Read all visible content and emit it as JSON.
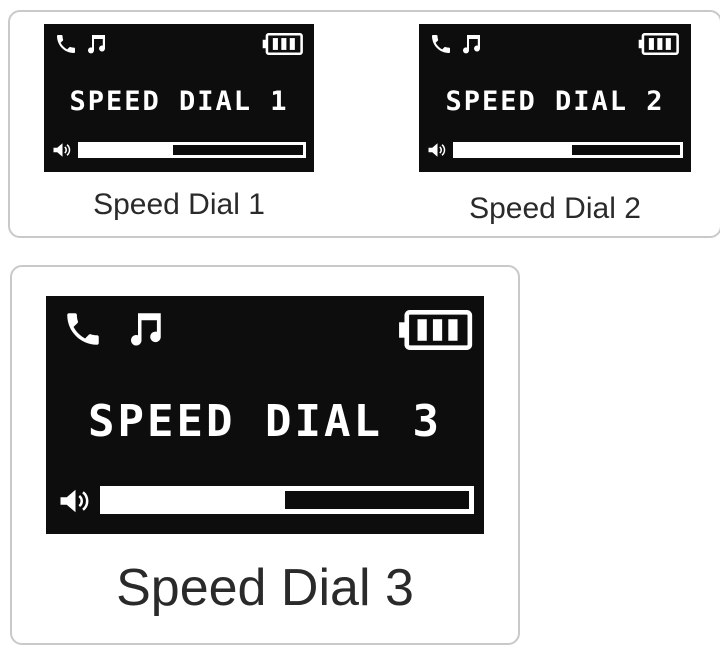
{
  "devices": [
    {
      "screen_text": "SPEED DIAL 1",
      "caption": "Speed Dial 1",
      "volume_fraction": 0.42,
      "status_icons": [
        "phone-icon",
        "music-note-icon"
      ],
      "battery_icon": "battery-full-icon",
      "volume_icon": "speaker-icon"
    },
    {
      "screen_text": "SPEED DIAL 2",
      "caption": "Speed Dial 2",
      "volume_fraction": 0.52,
      "status_icons": [
        "phone-icon",
        "music-note-icon"
      ],
      "battery_icon": "battery-full-icon",
      "volume_icon": "speaker-icon"
    },
    {
      "screen_text": "SPEED DIAL 3",
      "caption": "Speed Dial 3",
      "volume_fraction": 0.5,
      "status_icons": [
        "phone-icon",
        "music-note-icon"
      ],
      "battery_icon": "battery-full-icon",
      "volume_icon": "speaker-icon"
    }
  ],
  "colors": {
    "screen": "#0d0d0d",
    "screen_text": "#ffffff",
    "panel_border": "#c9c9c9",
    "caption": "#2a2a2a"
  }
}
